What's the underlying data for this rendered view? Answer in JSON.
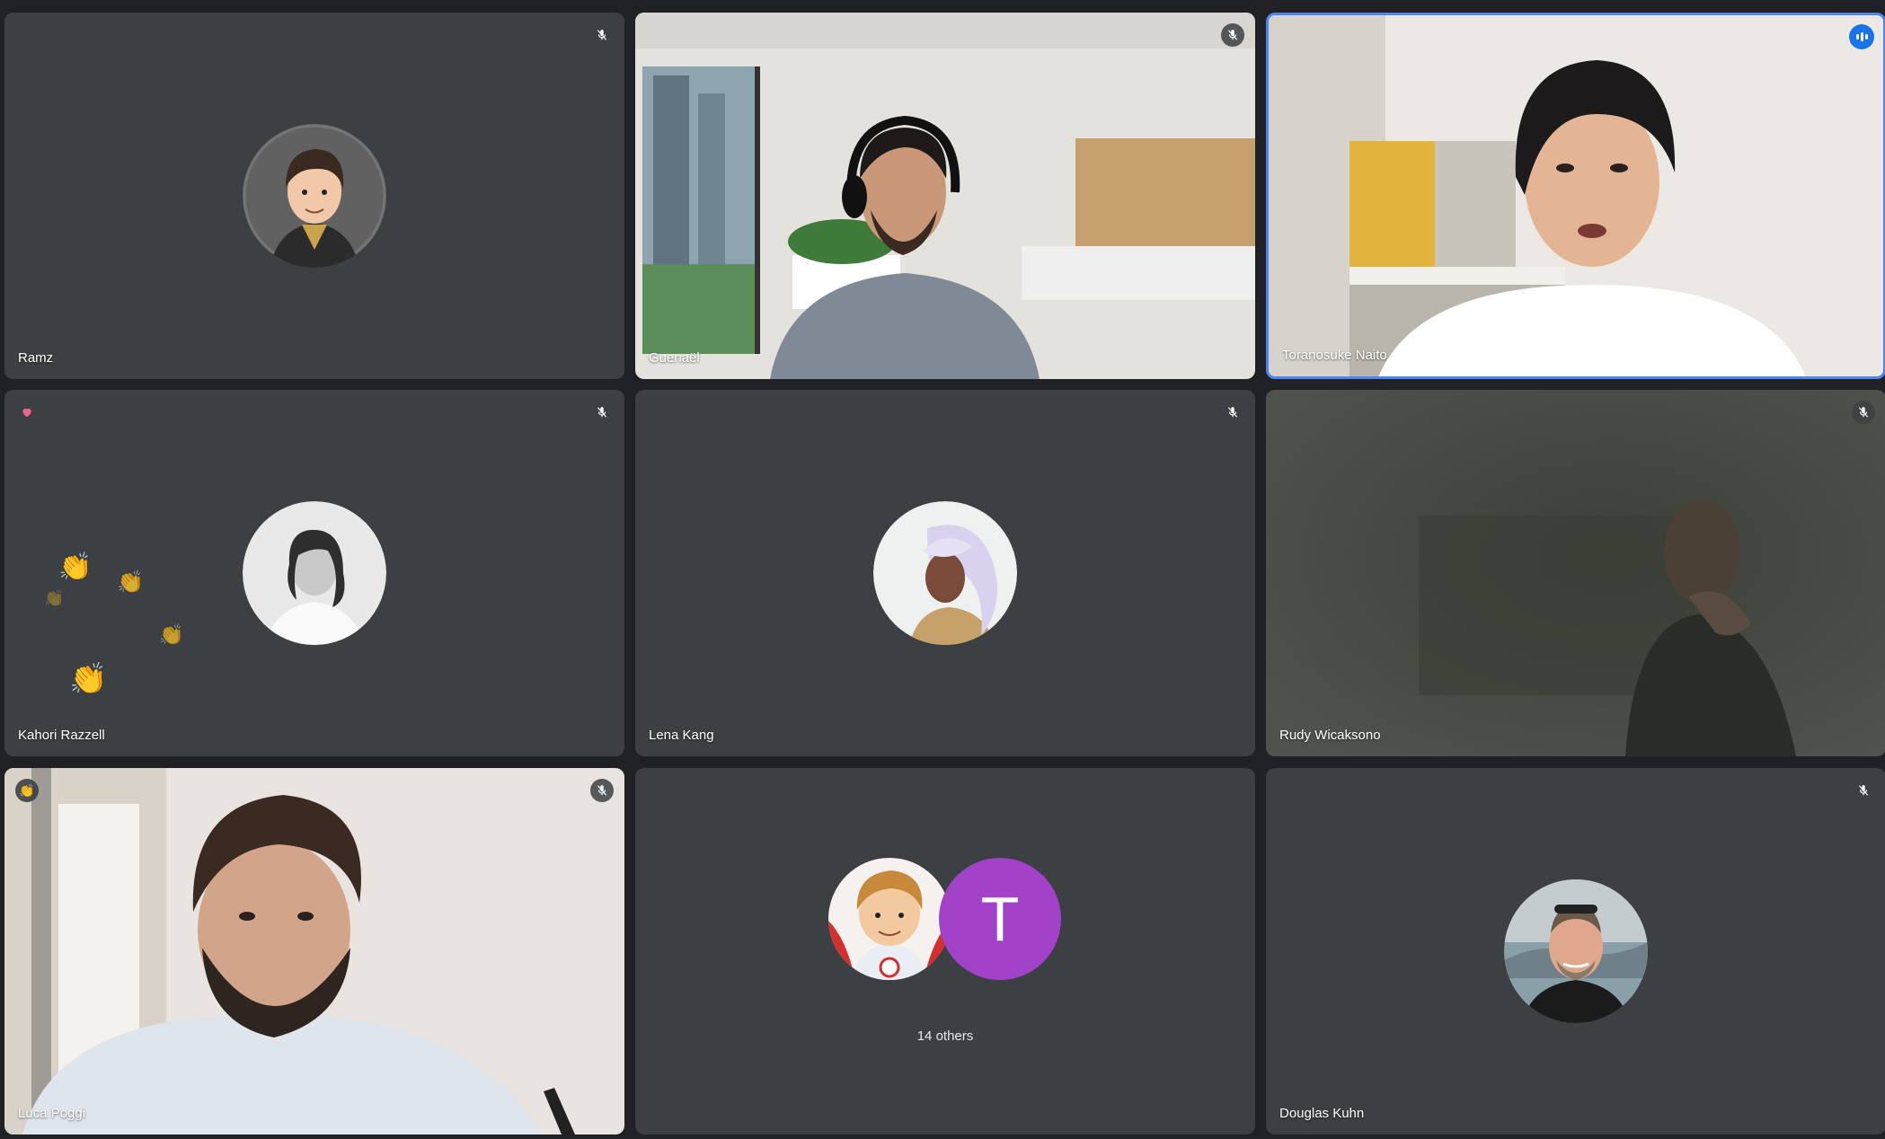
{
  "participants": [
    {
      "name": "Ramz"
    },
    {
      "name": "Guenaël"
    },
    {
      "name": "Toranosuke Naito"
    },
    {
      "name": "Kahori Razzell"
    },
    {
      "name": "Lena Kang"
    },
    {
      "name": "Rudy Wicaksono"
    },
    {
      "name": "Luca Poggi"
    },
    {
      "name": "Douglas Kuhn"
    }
  ],
  "others": {
    "label": "14 others",
    "initial": "T"
  },
  "icons": {
    "mic_off": "mic-off-icon",
    "speaking": "speaking-indicator-icon",
    "heart_reaction": "heart-reaction-icon",
    "clap_reaction": "clap-reaction-icon"
  },
  "colors": {
    "background": "#202124",
    "tile": "#3c4043",
    "active_border": "#4b84f3",
    "others_avatar": "#a142c8"
  }
}
